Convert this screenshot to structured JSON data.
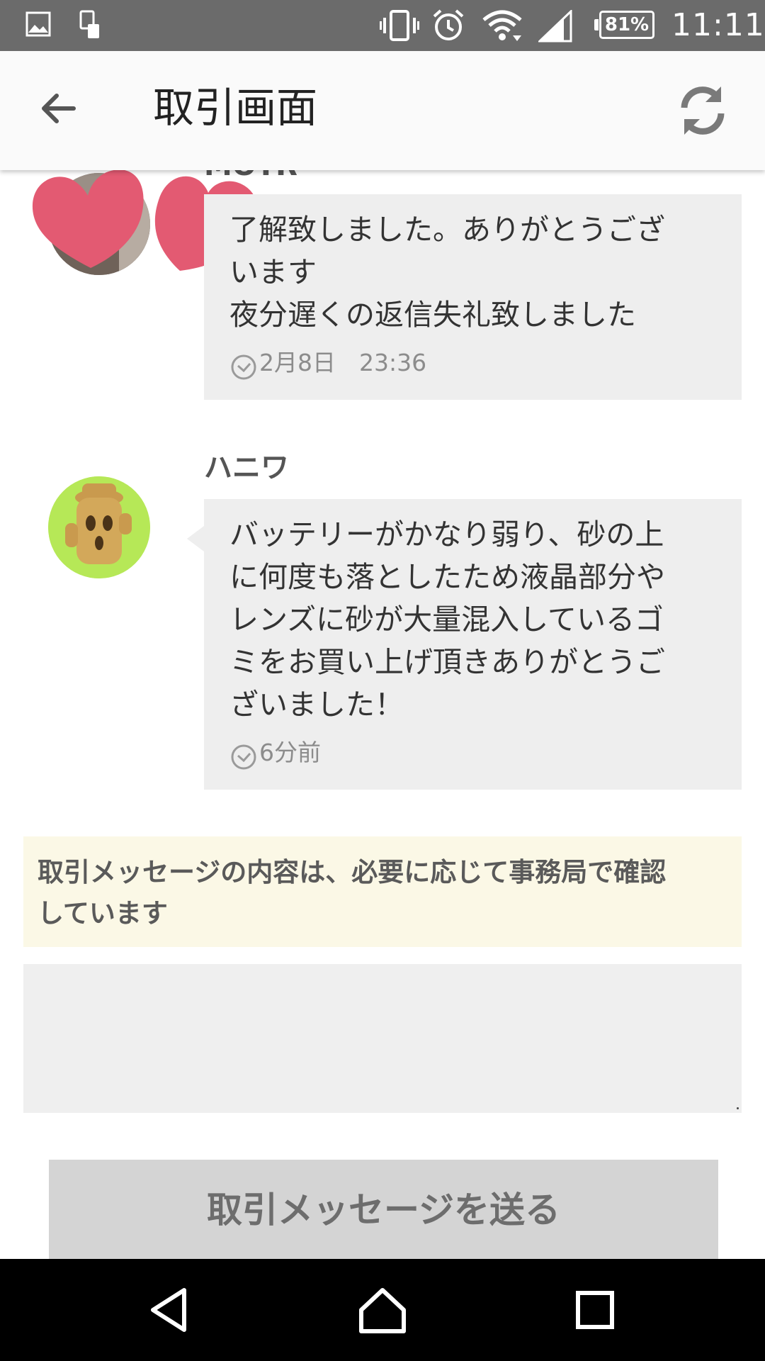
{
  "status_bar": {
    "icons": [
      "image-icon",
      "phone-icon",
      "vibrate-icon",
      "alarm-icon",
      "wifi-icon",
      "signal-icon"
    ],
    "battery": "81%",
    "time": "11:11"
  },
  "app_bar": {
    "title": "取引画面",
    "back_icon": "arrow-left-icon",
    "refresh_icon": "refresh-icon"
  },
  "messages": [
    {
      "sender": "MOTR",
      "lines": [
        "了解致しました。ありがとうござ",
        "います",
        "夜分遅くの返信失礼致しました"
      ],
      "time": "2月8日　23:36"
    },
    {
      "sender": "ハニワ",
      "lines": [
        "バッテリーがかなり弱り、砂の上",
        "に何度も落としたため液晶部分や",
        "レンズに砂が大量混入しているゴ",
        "ミをお買い上げ頂きありがとうご",
        "ざいました！"
      ],
      "time": "6分前"
    }
  ],
  "notice": {
    "lines": [
      "取引メッセージの内容は、必要に応じて事務局で確認",
      "しています"
    ]
  },
  "input": {
    "value": "",
    "placeholder": ""
  },
  "send_button": {
    "label": "取引メッセージを送る"
  },
  "nav_bar": {
    "icons": [
      "back-triangle-icon",
      "home-icon",
      "recents-icon"
    ]
  },
  "colors": {
    "status_bar": "#6b6b6b",
    "bubble": "#eeeeee",
    "notice_bg": "#fbf8e6",
    "button_bg": "#d4d4d4",
    "heart": "#e35a72",
    "avatar_bg": "#b6e857"
  }
}
